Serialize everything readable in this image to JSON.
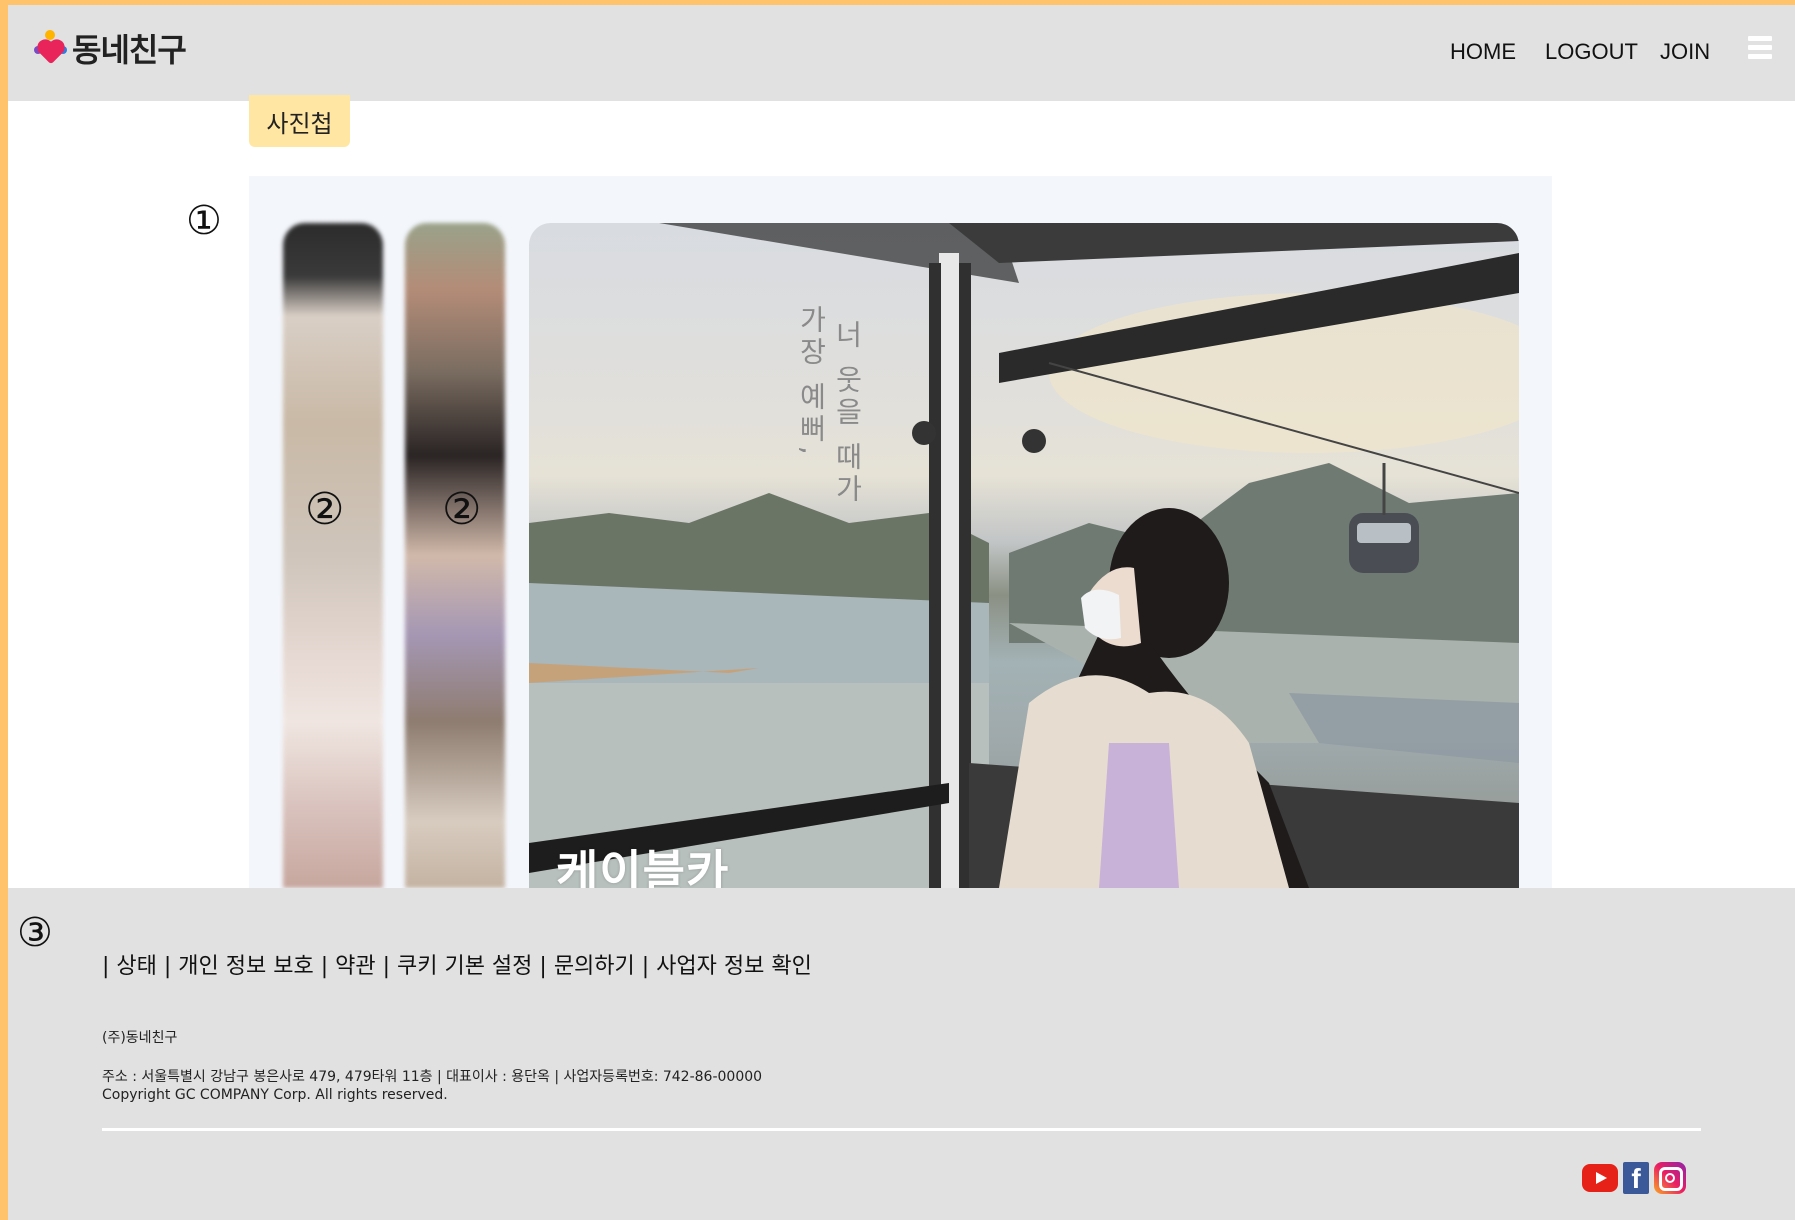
{
  "app": {
    "logo_text": "동네친구"
  },
  "nav": {
    "home": "HOME",
    "logout": "LOGOUT",
    "join": "JOIN",
    "menu_icon": "hamburger-icon"
  },
  "album": {
    "tag_label": "사진첩",
    "marker_1": "①",
    "marker_2": "②",
    "marker_3": "③",
    "poem_line_1": "너 웃을 때가",
    "poem_line_2": "가장 예뻐,",
    "caption": "케이블카"
  },
  "footer": {
    "links": "| 상태 | 개인 정보 보호 | 약관 | 쿠키 기본 설정 | 문의하기 | 사업자 정보 확인",
    "company": "(주)동네친구",
    "address": "주소 : 서울특별시 강남구 봉은사로 479, 479타워 11층 | 대표이사 : 용단옥 | 사업자등록번호: 742-86-00000",
    "copyright": "Copyright GC COMPANY Corp. All rights reserved.",
    "social": [
      "youtube-icon",
      "facebook-icon",
      "instagram-icon"
    ]
  },
  "colors": {
    "frame": "#ffc46b",
    "header_bg": "#e1e1e1",
    "tag_bg": "#ffe6a3"
  }
}
